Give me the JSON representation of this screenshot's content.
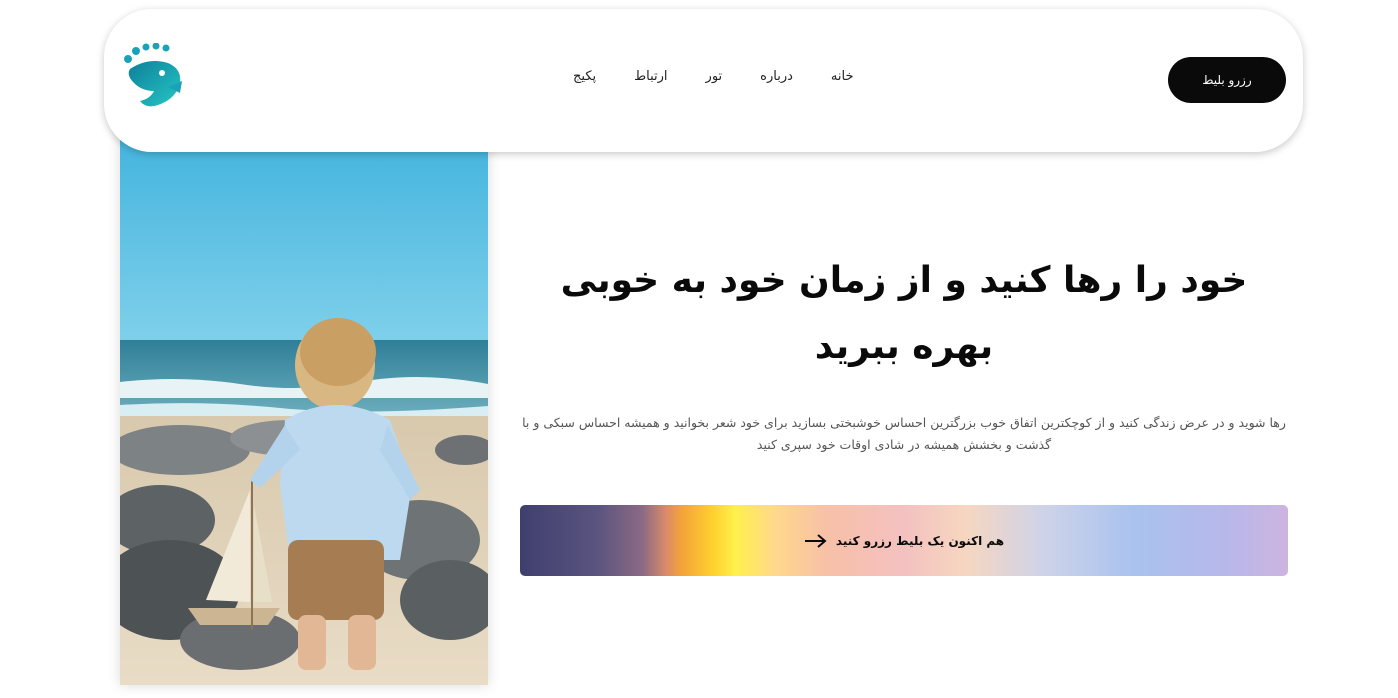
{
  "header": {
    "nav": [
      {
        "label": "پکیج"
      },
      {
        "label": "ارتباط"
      },
      {
        "label": "تور"
      },
      {
        "label": "درباره"
      },
      {
        "label": "خانه"
      }
    ],
    "book_button": "رزرو بلیط",
    "logo_icon": "seahorse-logo-icon"
  },
  "hero": {
    "title": "خود را رها کنید و از زمان خود به خوبی بهره ببرید",
    "description": "رها شوید و در عرض زندگی کنید و از کوچکترین اتفاق خوب بزرگترین احساس خوشبختی بسازید برای خود شعر بخوانید و همیشه احساس سبکی و با گذشت و بخشش همیشه در شادی اوقات خود سپری کنید",
    "cta_label": "هم اکنون یک بلیط رزرو کنید",
    "cta_icon": "arrow-right-icon"
  },
  "colors": {
    "accent": "#0a0a0a",
    "logo_teal": "#1aa3b8"
  }
}
